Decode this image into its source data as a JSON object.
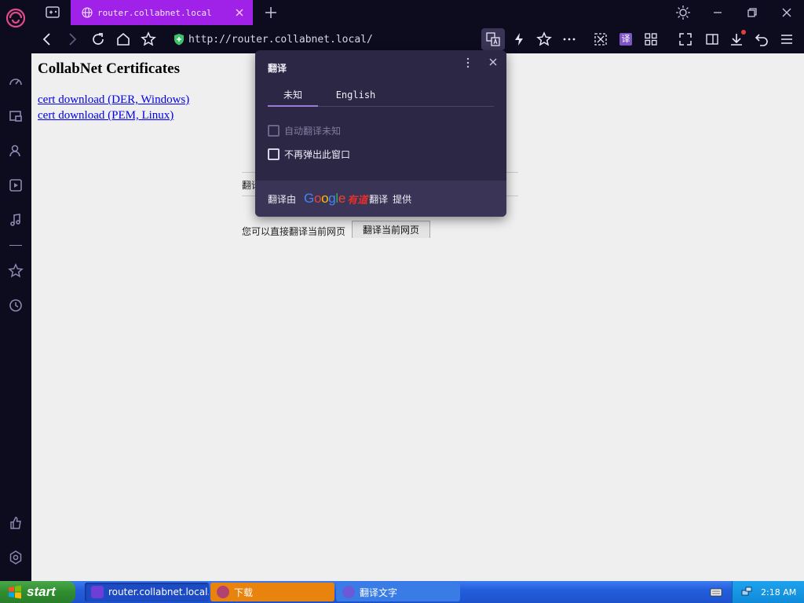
{
  "browser": {
    "active_tab_title": "router.collabnet.local",
    "url": "http://router.collabnet.local/"
  },
  "page": {
    "heading": "CollabNet Certificates",
    "links": [
      "cert download (DER, Windows)",
      "cert download (PEM, Linux)"
    ],
    "partial_text": "翻译",
    "direct_text": "您可以直接翻译当前网页",
    "direct_button": "翻译当前网页"
  },
  "popup": {
    "title": "翻译",
    "tabs": [
      "未知",
      "English"
    ],
    "auto_translate_label": "自动翻译未知",
    "never_show_label": "不再弹出此窗口",
    "footer_prefix": "翻译由",
    "google_text": "Google",
    "youdao_text": "有道",
    "footer_mid": "翻译",
    "footer_suffix": "提供"
  },
  "taskbar": {
    "start_label": "start",
    "tasks": [
      {
        "label": "router.collabnet.local..."
      },
      {
        "label": "下载"
      },
      {
        "label": "翻译文字"
      }
    ],
    "clock": "2:18 AM"
  },
  "colors": {
    "accent_tab": "#a022e8",
    "popup_bg": "#2b2745",
    "taskbar_blue": "#245edb",
    "start_green": "#2f8e2f"
  }
}
